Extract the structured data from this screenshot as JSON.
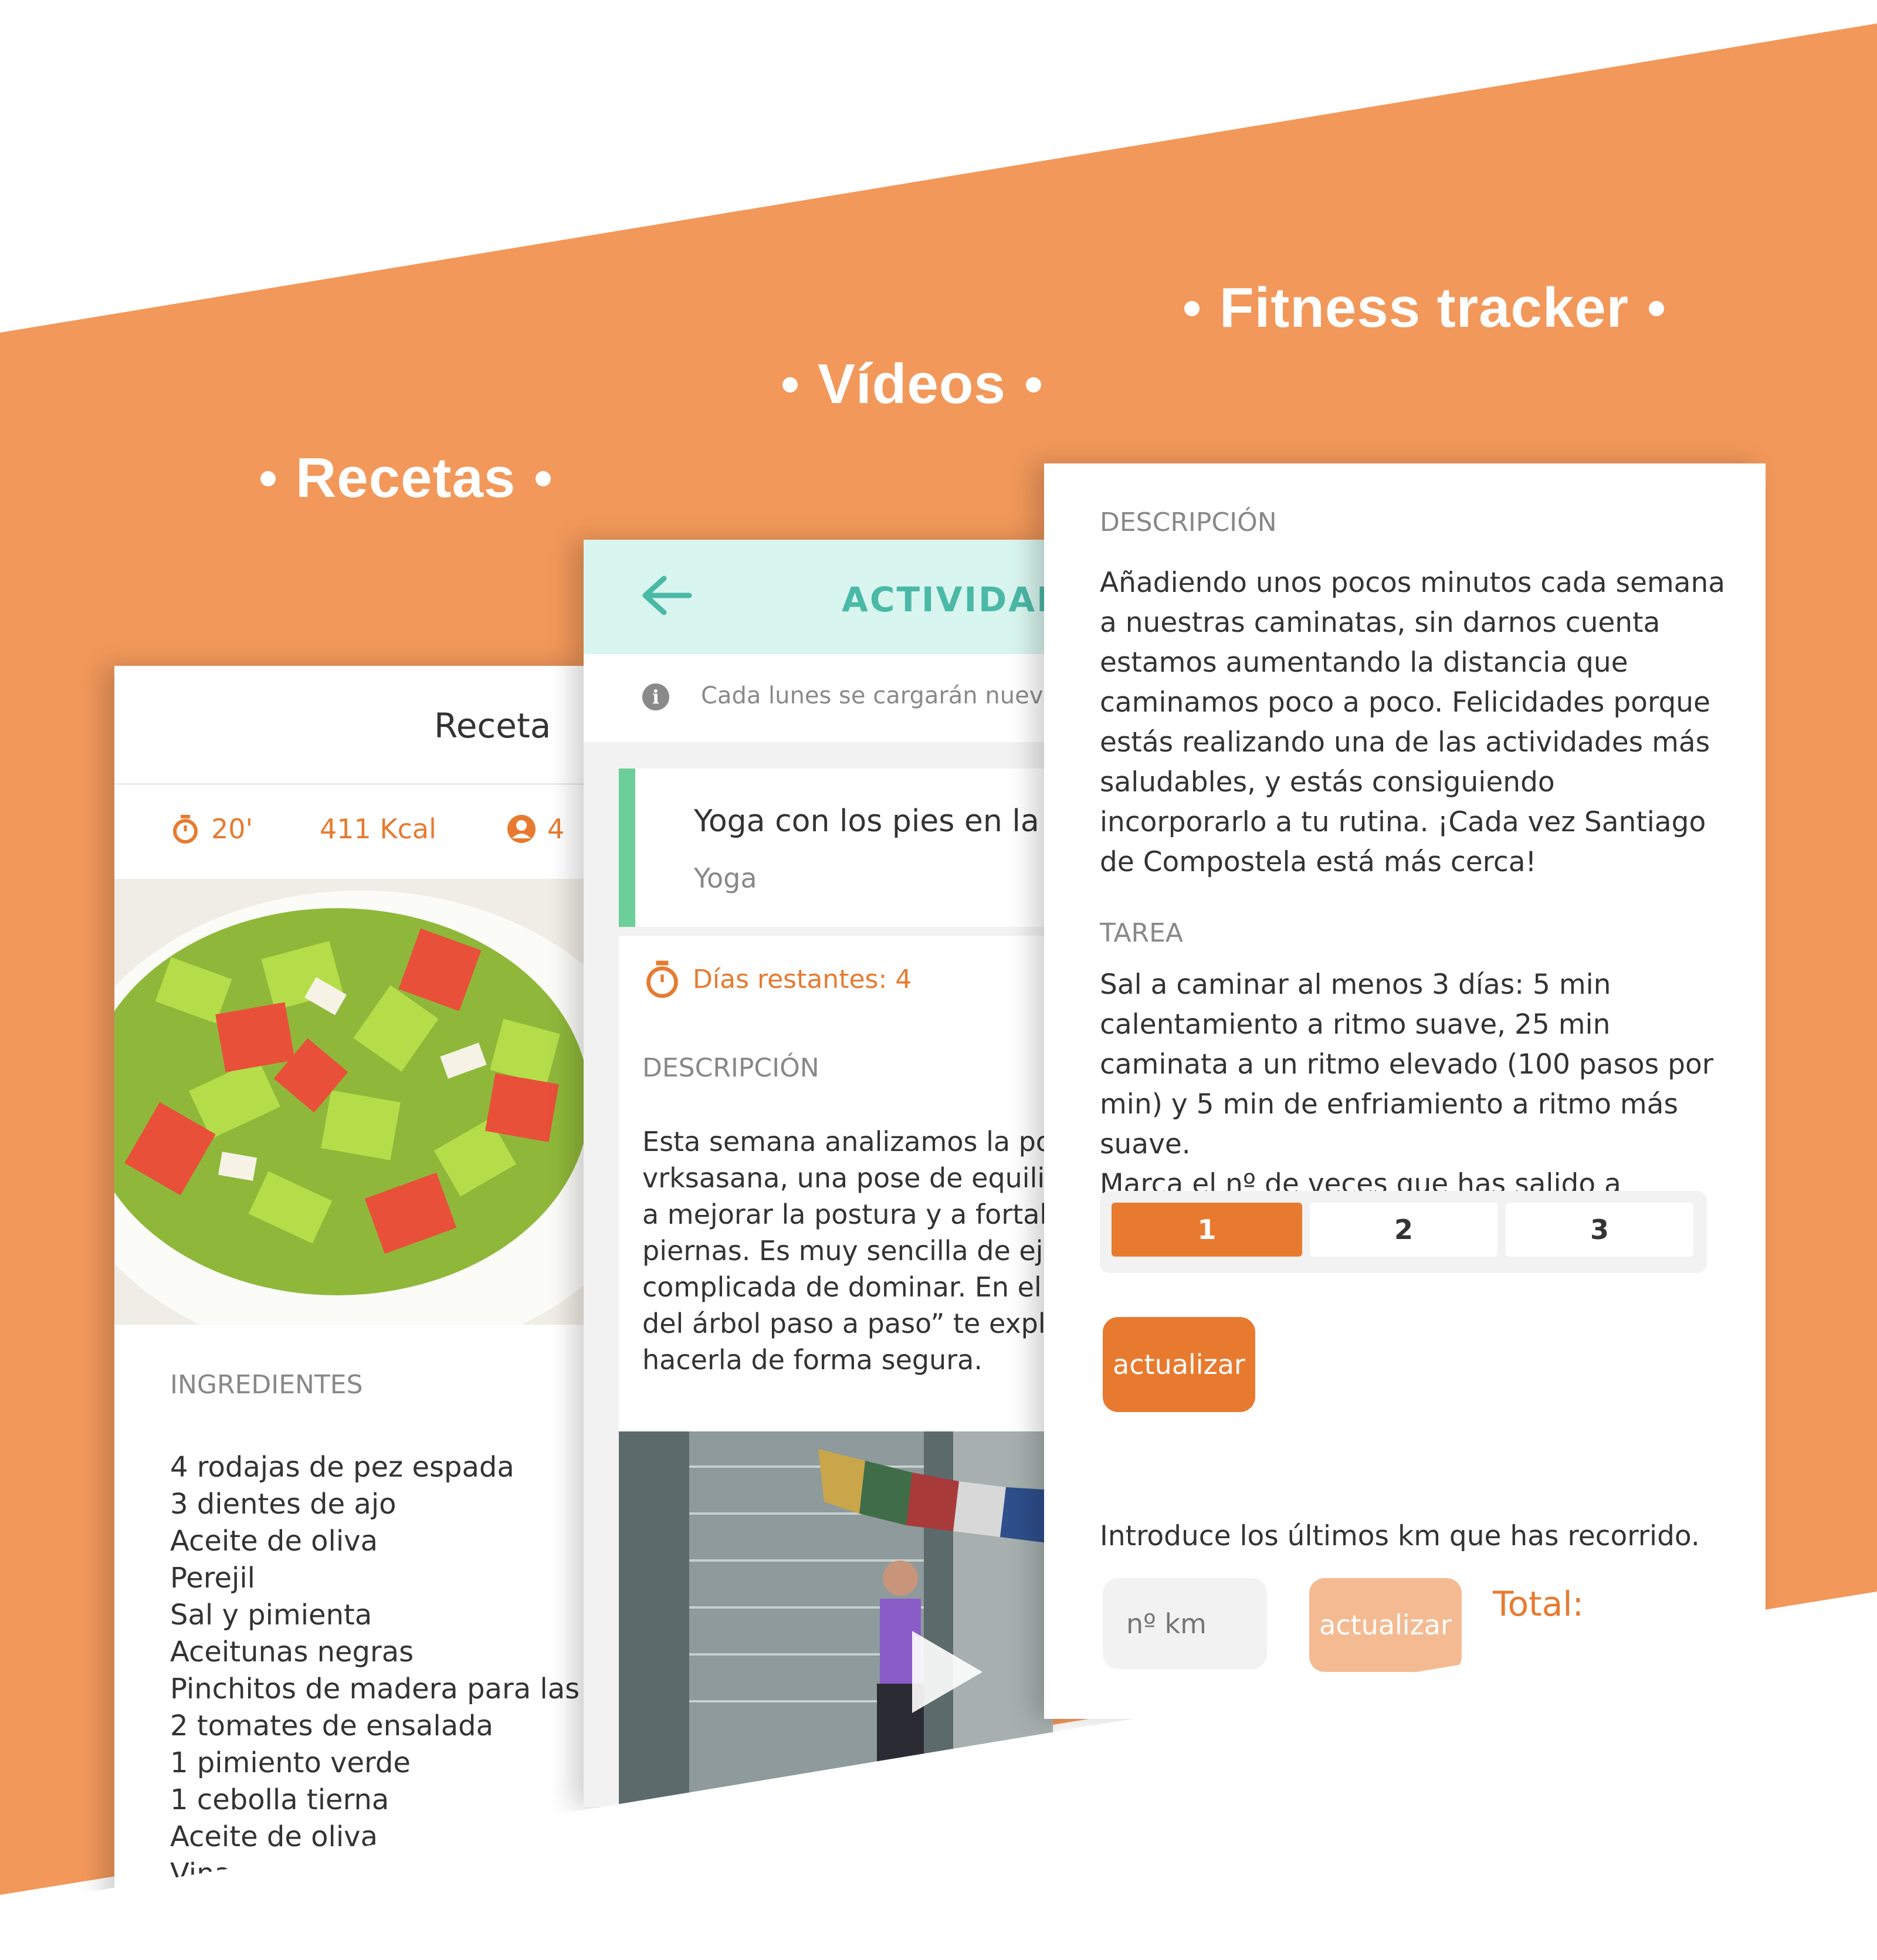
{
  "colors": {
    "brand_orange": "#F2985A",
    "accent_orange": "#E87A2F",
    "teal": "#4AB9A6",
    "mint_header": "#D9F5EF",
    "green_bar": "#6CCF9A"
  },
  "sections": {
    "recetas": "Recetas",
    "videos": "Vídeos",
    "fitness": "Fitness tracker"
  },
  "recipe": {
    "header_title": "Receta",
    "time": "20'",
    "calories": "411 Kcal",
    "servings": "4",
    "ingredients_label": "INGREDIENTES",
    "ingredients": [
      "4 rodajas de pez espada",
      "3 dientes de ajo",
      "Aceite de oliva",
      "Perejil",
      "Sal y pimienta",
      "Aceitunas negras",
      "Pinchitos de madera para las brochetas",
      "2 tomates de ensalada",
      "1 pimiento verde",
      "1 cebolla tierna",
      "Aceite de oliva",
      "Vinagre"
    ],
    "icons": {
      "timer": "stopwatch-icon",
      "user": "user-icon"
    }
  },
  "videos": {
    "header_title": "ACTIVIDADES",
    "info_text": "Cada lunes se cargarán nuevas actividades",
    "activity_name": "Yoga con los pies en la tierra",
    "activity_category": "Yoga",
    "days_left": "Días restantes: 4",
    "description_label": "DESCRIPCIÓN",
    "description_lines": [
      "Esta semana analizamos la pose de",
      "vrksasana, una pose de equilibrio que ayuda",
      "a mejorar la postura y a fortalecer las",
      "piernas.  Es muy sencilla de ejecutar pero",
      "complicada de dominar. En el vídeo “La pose",
      "del árbol paso a paso”  te explicamos cómo",
      "hacerla de forma segura."
    ],
    "icons": {
      "back": "back-arrow-icon",
      "info": "info-icon",
      "play": "play-icon"
    }
  },
  "fitness": {
    "description_label": "DESCRIPCIÓN",
    "description_text": "Añadiendo unos pocos minutos cada semana a nuestras caminatas, sin darnos cuenta estamos aumentando la distancia que caminamos poco a poco. Felicidades porque estás realizando una de las actividades más saludables, y estás consiguiendo incorporarlo a tu rutina. ¡Cada vez Santiago de Compostela está más cerca!",
    "task_label": "TAREA",
    "task_text": "Sal a caminar al menos 3 días: 5 min calentamiento a ritmo suave, 25 min caminata a un ritmo elevado (100 pasos por min) y 5 min de enfriamiento a ritmo más suave.",
    "mark_prompt": "Marca el nº de veces que has salido a caminar:",
    "segments": [
      "1",
      "2",
      "3"
    ],
    "selected_segment": "1",
    "update_button": "actualizar",
    "km_prompt": "Introduce los últimos km que has recorrido.",
    "km_placeholder": "nº km",
    "km_update_button": "actualizar",
    "total_label": "Total:"
  }
}
